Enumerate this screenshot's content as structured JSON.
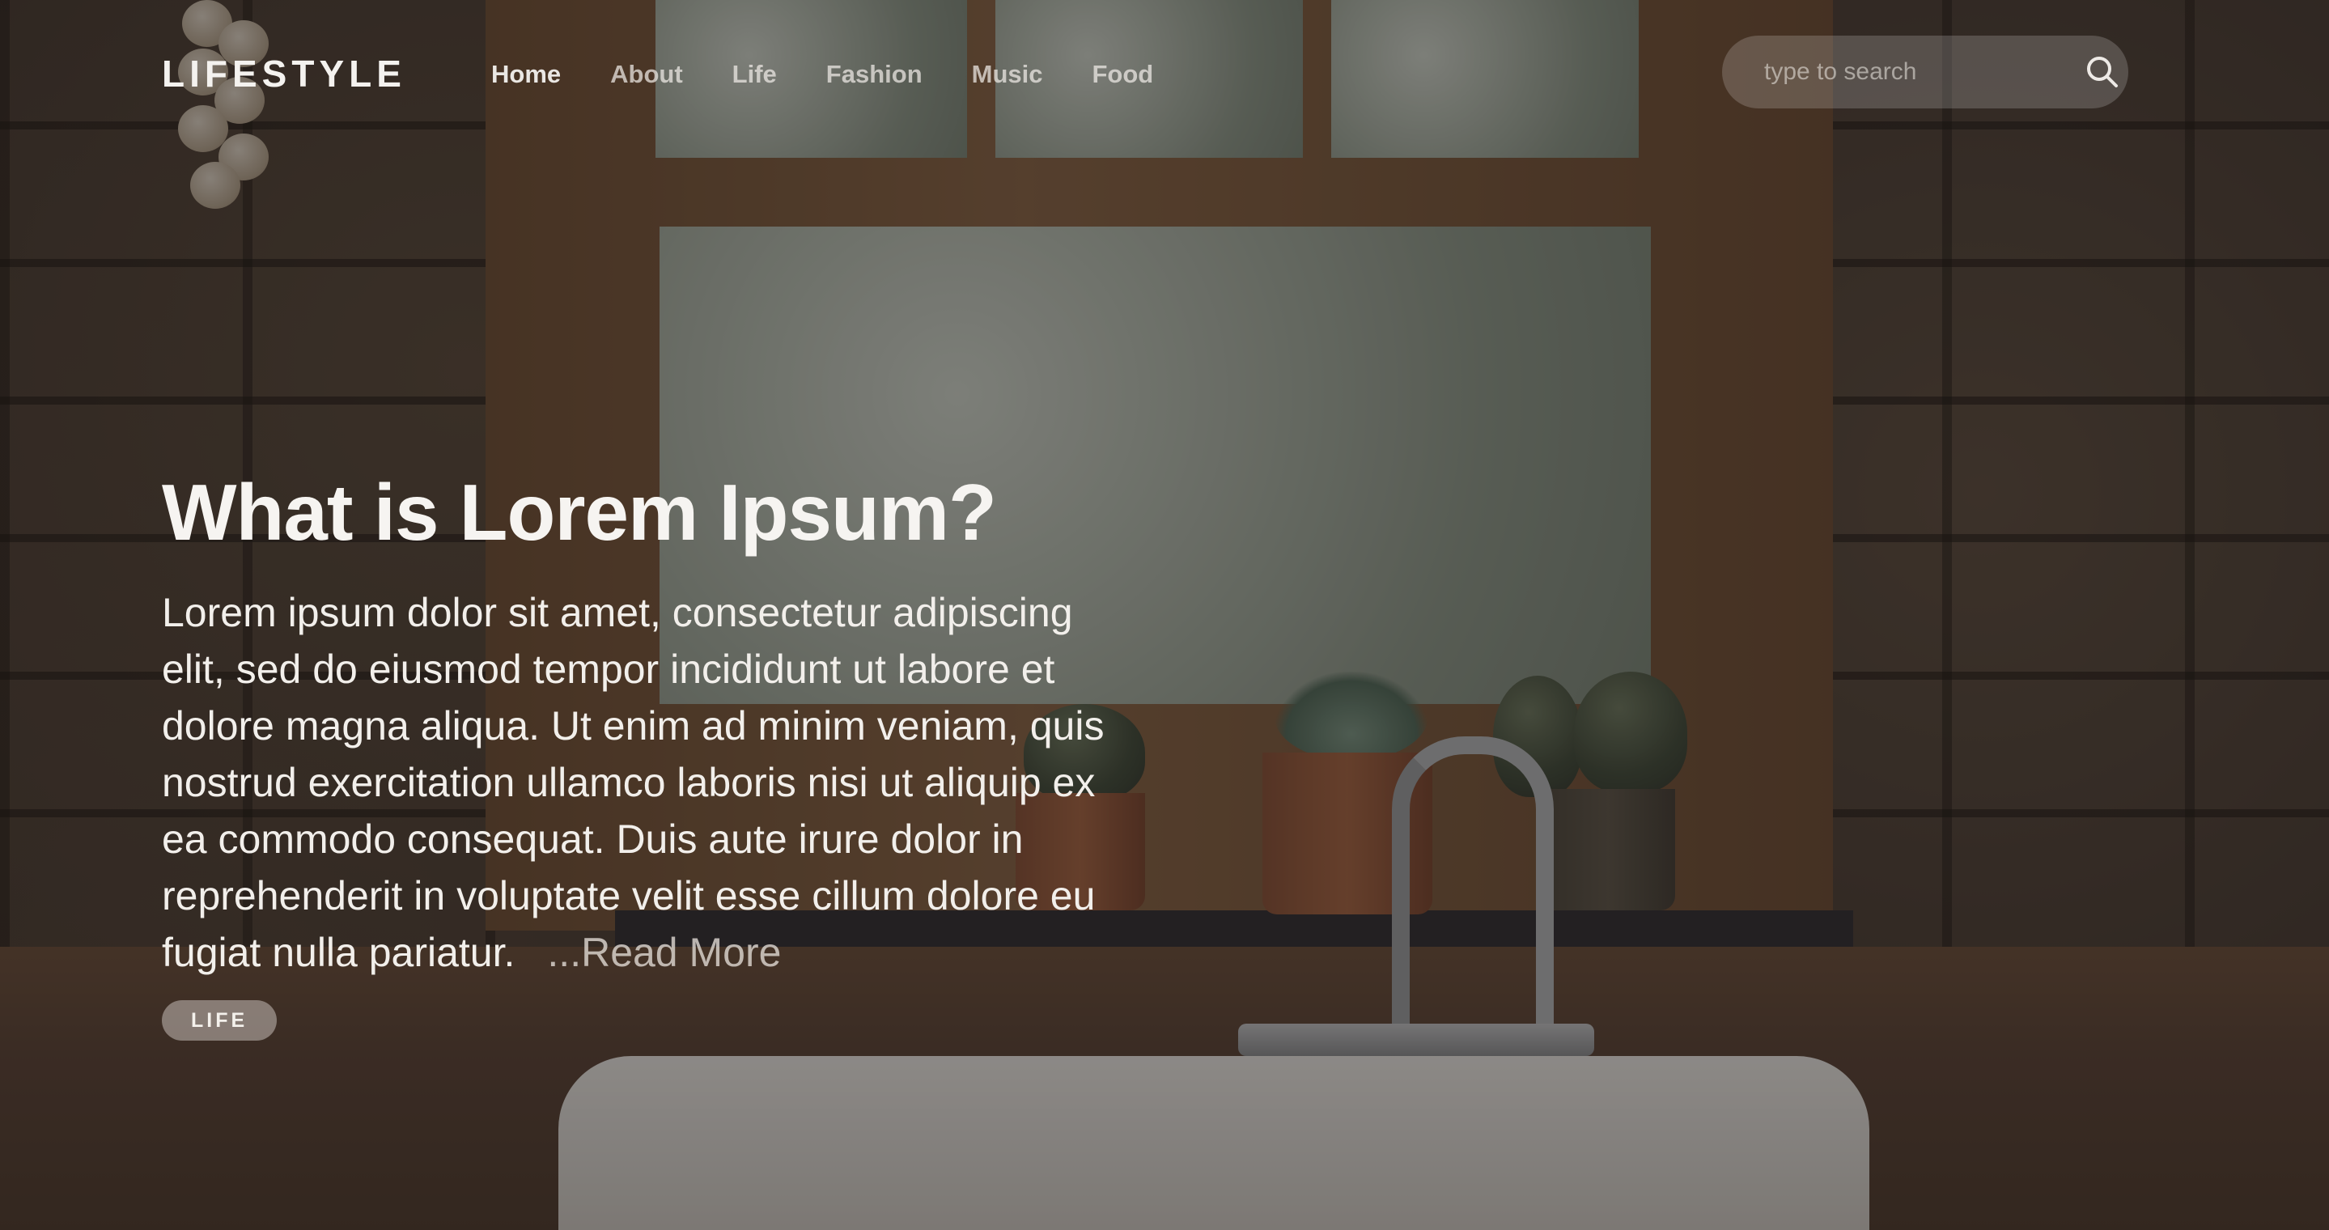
{
  "header": {
    "logo": "LIFESTYLE",
    "nav": [
      {
        "label": "Home"
      },
      {
        "label": "About"
      },
      {
        "label": "Life"
      },
      {
        "label": "Fashion"
      },
      {
        "label": "Music"
      },
      {
        "label": "Food"
      }
    ],
    "search": {
      "placeholder": "type to search",
      "value": "",
      "icon": "search-icon"
    }
  },
  "hero": {
    "title": "What is Lorem Ipsum?",
    "body": "Lorem ipsum dolor sit amet, consectetur adipiscing elit, sed do eiusmod tempor incididunt ut labore et dolore magna aliqua. Ut enim ad minim veniam, quis nostrud exercitation ullamco laboris nisi ut aliquip ex ea commodo consequat. Duis aute irure dolor in reprehenderit in voluptate velit esse cillum dolore eu fugiat nulla pariatur.",
    "read_more": "...Read More",
    "tag": "LIFE"
  },
  "colors": {
    "overlay": "#1c1816",
    "text": "#f6f4f1",
    "nav_text": "#f0ece8",
    "tag_bg": "#e2dcd6"
  }
}
